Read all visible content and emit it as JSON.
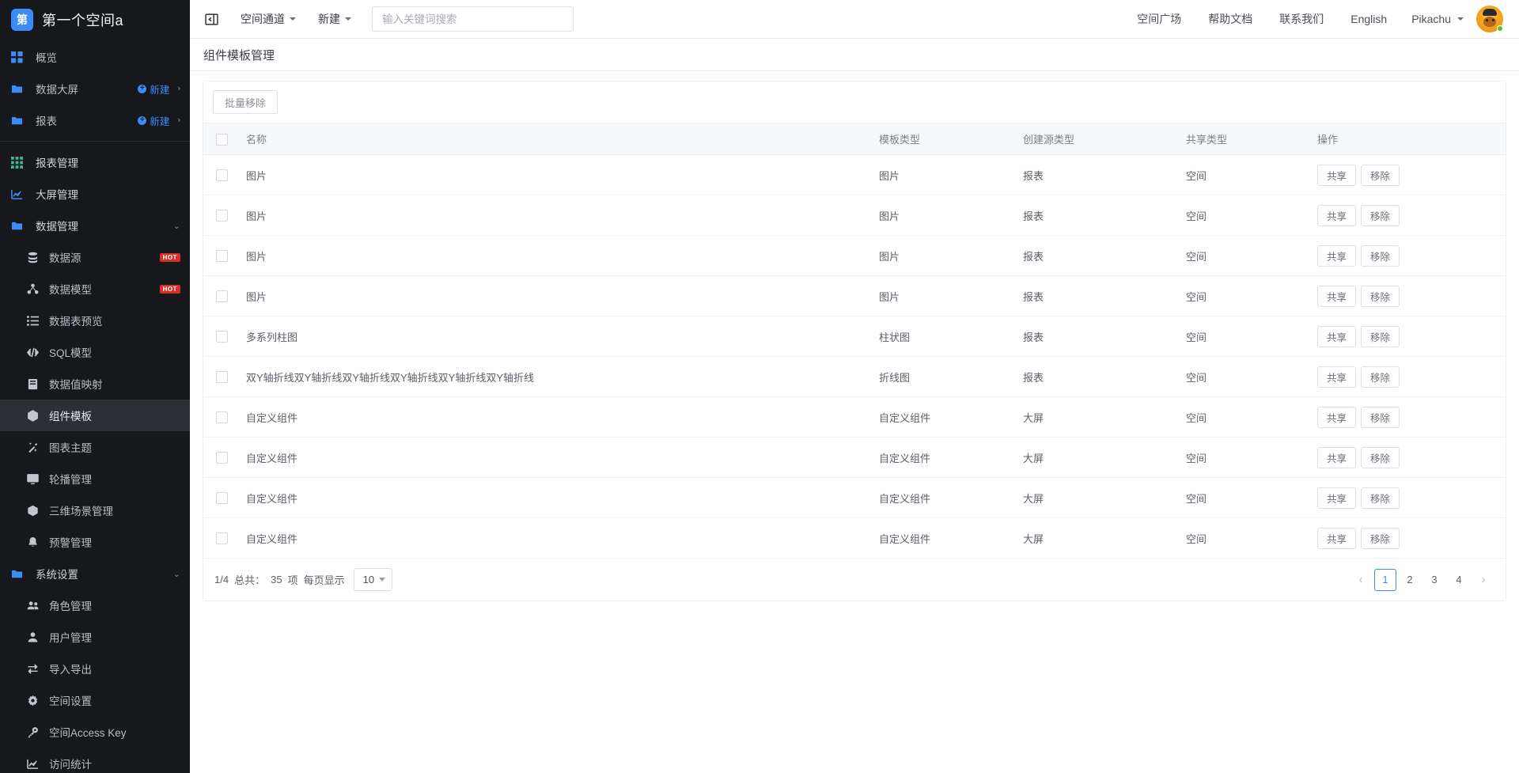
{
  "sidebar": {
    "logo_badge": "第",
    "workspace_name": "第一个空间a",
    "top_items": [
      {
        "label": "概览",
        "icon": "grid-icon",
        "new_label": null,
        "has_chevron": false
      },
      {
        "label": "数据大屏",
        "icon": "folder-icon",
        "new_label": "新建",
        "has_chevron": true
      },
      {
        "label": "报表",
        "icon": "folder-icon",
        "new_label": "新建",
        "has_chevron": true
      }
    ],
    "items": [
      {
        "label": "报表管理",
        "icon": "table-grid-icon",
        "badge": null
      },
      {
        "label": "大屏管理",
        "icon": "chart-line-icon",
        "badge": null
      },
      {
        "label": "数据管理",
        "icon": "folder-icon",
        "badge": null,
        "group": true,
        "expanded": true
      }
    ],
    "data_children": [
      {
        "label": "数据源",
        "icon": "database-icon",
        "badge": "HOT"
      },
      {
        "label": "数据模型",
        "icon": "model-icon",
        "badge": "HOT"
      },
      {
        "label": "数据表预览",
        "icon": "list-icon",
        "badge": null
      },
      {
        "label": "SQL模型",
        "icon": "code-icon",
        "badge": null
      },
      {
        "label": "数据值映射",
        "icon": "book-icon",
        "badge": null
      },
      {
        "label": "组件模板",
        "icon": "component-icon",
        "badge": null,
        "active": true
      },
      {
        "label": "图表主题",
        "icon": "magic-wand-icon",
        "badge": null
      },
      {
        "label": "轮播管理",
        "icon": "monitor-icon",
        "badge": null
      },
      {
        "label": "三维场景管理",
        "icon": "cube-icon",
        "badge": null
      },
      {
        "label": "预警管理",
        "icon": "bell-icon",
        "badge": null
      }
    ],
    "system_group": {
      "label": "系统设置",
      "icon": "folder-icon",
      "expanded": true
    },
    "system_children": [
      {
        "label": "角色管理",
        "icon": "users-icon"
      },
      {
        "label": "用户管理",
        "icon": "user-icon"
      },
      {
        "label": "导入导出",
        "icon": "transfer-icon"
      },
      {
        "label": "空间设置",
        "icon": "gear-icon"
      },
      {
        "label": "空间Access Key",
        "icon": "key-icon"
      },
      {
        "label": "访问统计",
        "icon": "chart-line-icon"
      }
    ]
  },
  "topbar": {
    "collapse_icon": "collapse-sidebar-icon",
    "menus": [
      {
        "label": "空间通道",
        "has_caret": true
      },
      {
        "label": "新建",
        "has_caret": true
      }
    ],
    "search_placeholder": "输入关键词搜索",
    "search_value": "",
    "links": [
      "空间广场",
      "帮助文档",
      "联系我们",
      "English"
    ],
    "user_name": "Pikachu",
    "avatar_status": "online"
  },
  "page": {
    "title": "组件模板管理"
  },
  "toolbar": {
    "batch_remove_label": "批量移除"
  },
  "table": {
    "columns": [
      "名称",
      "模板类型",
      "创建源类型",
      "共享类型",
      "操作"
    ],
    "op_share_label": "共享",
    "op_remove_label": "移除",
    "rows": [
      {
        "name": "图片",
        "template_type": "图片",
        "source_type": "报表",
        "share_type": "空间"
      },
      {
        "name": "图片",
        "template_type": "图片",
        "source_type": "报表",
        "share_type": "空间"
      },
      {
        "name": "图片",
        "template_type": "图片",
        "source_type": "报表",
        "share_type": "空间"
      },
      {
        "name": "图片",
        "template_type": "图片",
        "source_type": "报表",
        "share_type": "空间"
      },
      {
        "name": "多系列柱图",
        "template_type": "柱状图",
        "source_type": "报表",
        "share_type": "空间"
      },
      {
        "name": "双Y轴折线双Y轴折线双Y轴折线双Y轴折线双Y轴折线双Y轴折线",
        "template_type": "折线图",
        "source_type": "报表",
        "share_type": "空间"
      },
      {
        "name": "自定义组件",
        "template_type": "自定义组件",
        "source_type": "大屏",
        "share_type": "空间"
      },
      {
        "name": "自定义组件",
        "template_type": "自定义组件",
        "source_type": "大屏",
        "share_type": "空间"
      },
      {
        "name": "自定义组件",
        "template_type": "自定义组件",
        "source_type": "大屏",
        "share_type": "空间"
      },
      {
        "name": "自定义组件",
        "template_type": "自定义组件",
        "source_type": "大屏",
        "share_type": "空间"
      }
    ]
  },
  "pagination": {
    "page_ratio": "1/4",
    "total_label": "总共：",
    "total_count": "35",
    "unit_label": "项",
    "per_page_label": "每页显示",
    "per_page_value": "10",
    "pages": [
      "1",
      "2",
      "3",
      "4"
    ],
    "active_page": "1",
    "prev_icon": "chevron-left-icon",
    "next_icon": "chevron-right-icon"
  },
  "colors": {
    "accent": "#3c8cf8",
    "sidebar_bg": "#16181c",
    "hot_badge": "#d93025",
    "online": "#52c41a"
  }
}
